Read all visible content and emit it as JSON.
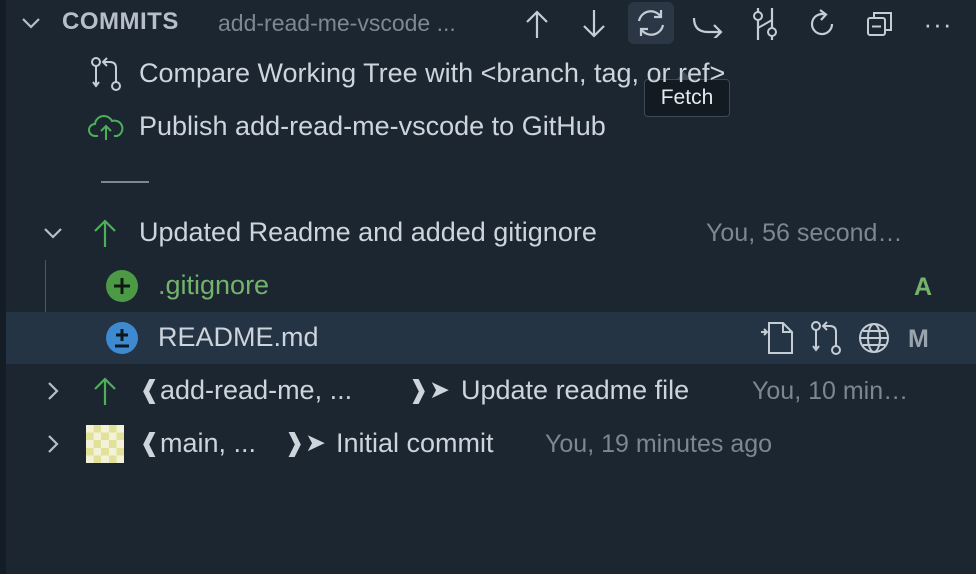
{
  "header": {
    "title": "COMMITS",
    "branch": "add-read-me-vscode ...",
    "toolbar": [
      "arrow-up-icon",
      "arrow-down-icon",
      "sync-icon",
      "forward-icon",
      "branch-compare-icon",
      "refresh-icon",
      "collapse-all-icon",
      "more-icon"
    ],
    "more_label": "···"
  },
  "tooltip": {
    "text": "Fetch"
  },
  "actions": {
    "compare": "Compare Working Tree with <branch, tag, or ref>",
    "publish": "Publish add-read-me-vscode to GitHub"
  },
  "commits": [
    {
      "message": "Updated Readme and added gitignore",
      "meta": "You, 56 second…",
      "files": [
        {
          "name": ".gitignore",
          "status": "A",
          "color": "#73b36b"
        },
        {
          "name": "README.md",
          "status": "M",
          "color": "#9aa4ad"
        }
      ]
    },
    {
      "refs_open": "❰",
      "refs": "add-read-me, ...",
      "refs_close": "❱➤",
      "message": "Update readme file",
      "meta": "You, 10 min…"
    },
    {
      "refs_open": "❰",
      "refs": "main, ...",
      "refs_close": "❱➤",
      "message": "Initial commit",
      "meta": "You, 19 minutes ago"
    }
  ],
  "colors": {
    "accent_green": "#4fae59",
    "added": "#73b36b",
    "modified_icon": "#3d8ad1",
    "background": "#1b2631",
    "selected": "#253444"
  }
}
